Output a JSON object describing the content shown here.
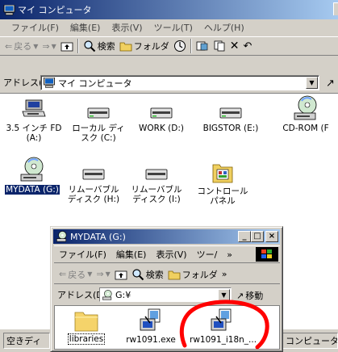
{
  "main_window": {
    "title": "マイ コンピュータ",
    "menu": [
      "ファイル(F)",
      "編集(E)",
      "表示(V)",
      "ツール(T)",
      "ヘルプ(H)"
    ],
    "toolbar": {
      "back": "戻る",
      "search": "検索",
      "folders": "フォルダ"
    },
    "address_label": "アドレス(D)",
    "address_value": "マイ コンピュータ",
    "items": [
      {
        "label": "3.5 インチ FD (A:)",
        "icon": "floppy-drive-icon"
      },
      {
        "label": "ローカル ディスク (C:)",
        "icon": "hard-disk-icon"
      },
      {
        "label": "WORK (D:)",
        "icon": "hard-disk-icon"
      },
      {
        "label": "BIGSTOR (E:)",
        "icon": "hard-disk-icon"
      },
      {
        "label": "CD-ROM (F",
        "icon": "cd-drive-icon"
      },
      {
        "label": "MYDATA (G:)",
        "icon": "cd-drive-icon"
      },
      {
        "label": "リムーバブル ディスク (H:)",
        "icon": "removable-disk-icon"
      },
      {
        "label": "リムーバブル ディスク (I:)",
        "icon": "removable-disk-icon"
      },
      {
        "label": "コントロール パネル",
        "icon": "control-panel-icon"
      }
    ],
    "status_left": "空きディ",
    "status_right": "コンピュータ"
  },
  "child_window": {
    "title": "MYDATA (G:)",
    "menu": [
      "ファイル(F)",
      "編集(E)",
      "表示(V)",
      "ツー/",
      "»"
    ],
    "toolbar": {
      "back": "戻る",
      "search": "検索",
      "folders": "フォルダ",
      "more": "»"
    },
    "address_label": "アドレス(D)",
    "address_value": "G:¥",
    "go_label": "移動",
    "items": [
      {
        "label": "libraries",
        "icon": "folder-icon"
      },
      {
        "label": "rw1091.exe",
        "icon": "installer-icon"
      },
      {
        "label": "rw1091_i18n_...",
        "icon": "installer-icon"
      }
    ]
  },
  "colors": {
    "titlebar_start": "#0a246a",
    "titlebar_end": "#a6caf0",
    "face": "#d4d0c8",
    "annotation": "#ff0000"
  }
}
